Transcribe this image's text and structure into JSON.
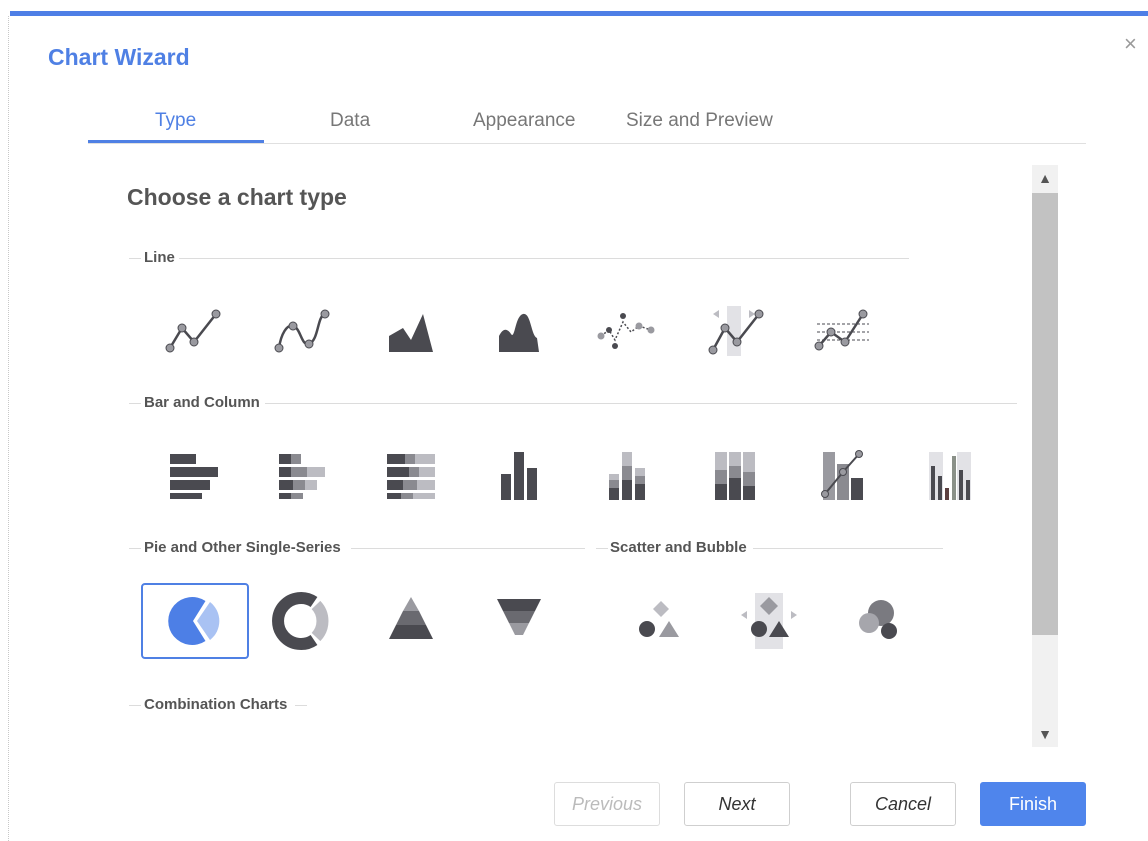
{
  "dialog": {
    "title": "Chart Wizard",
    "close_glyph": "×"
  },
  "tabs": [
    {
      "label": "Type",
      "active": true
    },
    {
      "label": "Data",
      "active": false
    },
    {
      "label": "Appearance",
      "active": false
    },
    {
      "label": "Size and Preview",
      "active": false
    }
  ],
  "content": {
    "heading": "Choose a chart type",
    "sections": {
      "line": "Line",
      "bar": "Bar and Column",
      "pie": "Pie and Other Single-Series",
      "scatter": "Scatter and Bubble",
      "combo": "Combination Charts"
    },
    "line_icons": [
      "line-icon",
      "smooth-line-icon",
      "area-icon",
      "smooth-area-icon",
      "scatter-line-icon",
      "step-line-icon",
      "line-with-bands-icon"
    ],
    "bar_icons": [
      "bar-icon",
      "stacked-bar-icon",
      "percent-stacked-bar-icon",
      "column-icon",
      "stacked-column-icon",
      "percent-stacked-column-icon",
      "column-line-icon",
      "range-column-icon"
    ],
    "pie_icons": [
      "pie-icon",
      "donut-icon",
      "pyramid-icon",
      "funnel-icon"
    ],
    "scatter_icons": [
      "scatter-icon",
      "scatter-with-axes-icon",
      "bubble-icon"
    ],
    "selected_type": "pie-icon"
  },
  "colors": {
    "accent": "#4f80e4",
    "icon_dark": "#4a4a50",
    "icon_mid": "#8a8a90",
    "icon_light": "#bcbcc2",
    "selected_fill": "#4d7fe6"
  },
  "buttons": {
    "previous": "Previous",
    "next": "Next",
    "cancel": "Cancel",
    "finish": "Finish"
  },
  "scrollbar": {
    "up_glyph": "▲",
    "down_glyph": "▼"
  }
}
